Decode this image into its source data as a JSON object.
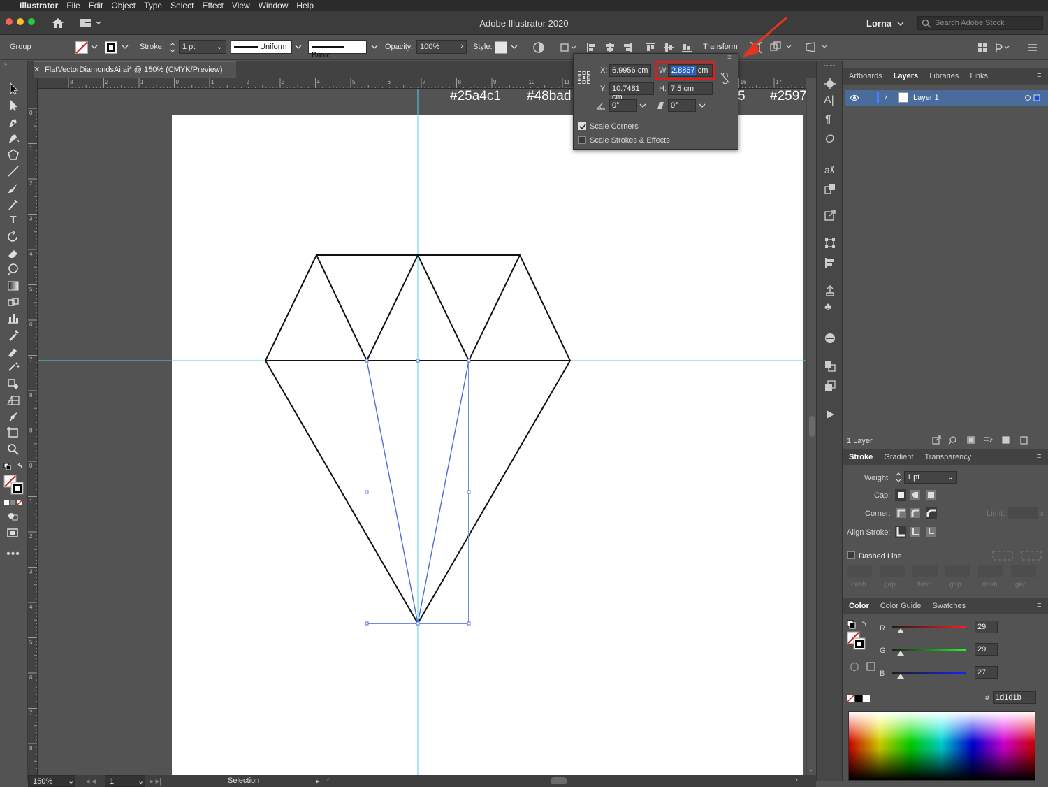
{
  "menubar": {
    "apple": "",
    "app_name": "Illustrator",
    "items": [
      "File",
      "Edit",
      "Object",
      "Type",
      "Select",
      "Effect",
      "View",
      "Window",
      "Help"
    ]
  },
  "titlebar": {
    "title": "Adobe Illustrator 2020",
    "user": "Lorna",
    "search_placeholder": "Search Adobe Stock"
  },
  "control": {
    "selection_type": "Group",
    "stroke_label": "Stroke:",
    "stroke_weight": "1 pt",
    "profile_label": "Uniform",
    "brush_label": "Basic",
    "opacity_label": "Opacity:",
    "opacity_value": "100%",
    "style_label": "Style:",
    "transform_link": "Transform"
  },
  "document_tab": {
    "close": "✕",
    "title": "FlatVectorDiamondsAi.ai* @ 150% (CMYK/Preview)"
  },
  "hruler_ticks": [
    "3",
    "2",
    "1",
    "0",
    "1",
    "2",
    "3",
    "4",
    "5",
    "6",
    "7",
    "8",
    "9",
    "10",
    "11",
    "12",
    "13",
    "14",
    "15",
    "16",
    "17"
  ],
  "vruler_ticks": [
    "0",
    "1",
    "2",
    "3",
    "4",
    "5",
    "6",
    "7",
    "8",
    "9",
    "0",
    "1",
    "2",
    "3",
    "4",
    "5",
    "6",
    "7",
    "8"
  ],
  "canvas_labels": [
    "#25a4c1",
    "#48bad",
    "5",
    "#2597"
  ],
  "transform_popup": {
    "x_label": "X:",
    "x_value": "6.9956 cm",
    "w_label": "W:",
    "w_value": "2.8867",
    "w_unit": "cm",
    "y_label": "Y:",
    "y_value": "10.7481 cm",
    "h_label": "H:",
    "h_value": "7.5 cm",
    "rotate_value": "0°",
    "shear_value": "0°",
    "scale_corners": "Scale Corners",
    "scale_corners_checked": true,
    "scale_strokes": "Scale Strokes & Effects",
    "scale_strokes_checked": false
  },
  "status": {
    "zoom": "150%",
    "artboard": "1",
    "tool": "Selection"
  },
  "layers_panel": {
    "tabs": [
      "Artboards",
      "Layers",
      "Libraries",
      "Links"
    ],
    "active_tab": "Layers",
    "layer_name": "Layer 1",
    "footer": "1 Layer"
  },
  "stroke_panel": {
    "tabs": [
      "Stroke",
      "Gradient",
      "Transparency"
    ],
    "weight_label": "Weight:",
    "weight_value": "1 pt",
    "cap_label": "Cap:",
    "corner_label": "Corner:",
    "limit_label": "Limit:",
    "limit_close": "x",
    "align_label": "Align Stroke:",
    "dashed_label": "Dashed Line",
    "dash_labels": [
      "dash",
      "gap",
      "dash",
      "gap",
      "dash",
      "gap"
    ]
  },
  "color_panel": {
    "tabs": [
      "Color",
      "Color Guide",
      "Swatches"
    ],
    "r_label": "R",
    "r_value": "29",
    "g_label": "G",
    "g_value": "29",
    "b_label": "B",
    "b_value": "27",
    "hex_prefix": "#",
    "hex_value": "1d1d1b"
  },
  "colors": {
    "guide": "#4fd3e6",
    "selection": "#4a6fd8",
    "highlight": "#e21b1b",
    "arrow": "#e8341c"
  }
}
